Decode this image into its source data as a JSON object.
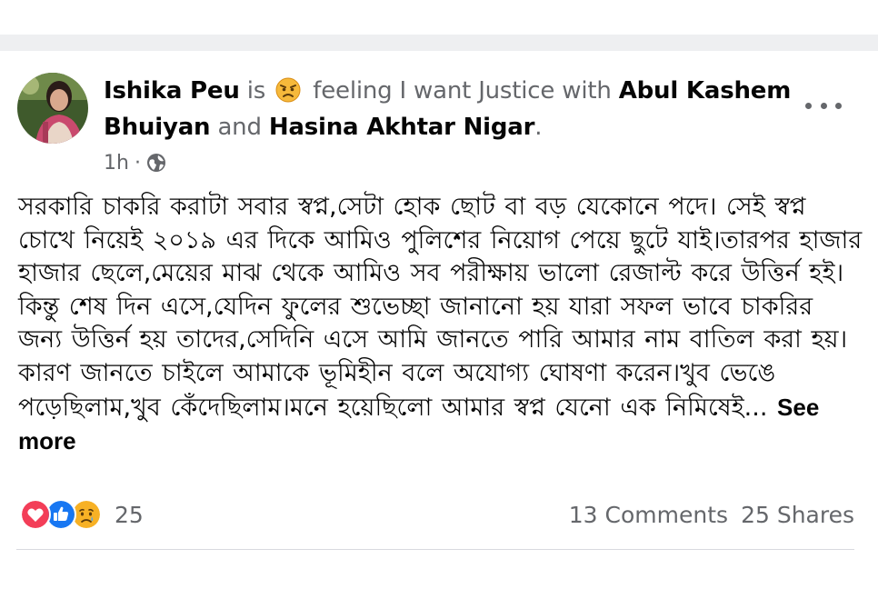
{
  "post": {
    "author": "Ishika Peu",
    "is_text": "is",
    "feeling_text": "feeling I want Justice with",
    "tagged_1": "Abul Kashem Bhuiyan",
    "and_text": "and",
    "tagged_2": "Hasina Akhtar Nigar",
    "period": ".",
    "feeling_icon": "angry-face-emoji",
    "time": "1h",
    "separator": "·",
    "privacy_icon": "globe-icon",
    "body": "সরকারি চাকরি করাটা সবার স্বপ্ন,সেটা হোক ছোট বা বড় যেকোনে পদে। সেই স্বপ্ন চোখে নিয়েই ২০১৯ এর দিকে আমিও পুলিশের নিয়োগ পেয়ে ছুটে যাই।তারপর হাজার হাজার ছেলে,মেয়ের মাঝ থেকে আমিও সব পরীক্ষায় ভালো রেজাল্ট করে উত্তির্ন হই।কিন্তু শেষ দিন এসে,যেদিন ফুলের শুভেচ্ছা জানানো হয় যারা সফল ভাবে চাকরির জন্য উত্তির্ন হয় তাদের,সেদিনি এসে আমি জানতে পারি আমার নাম বাতিল করা হয়।কারণ জানতে চাইলে আমাকে ভূমিহীন বলে অযোগ্য ঘোষণা করেন।খুব ভেঙে পড়েছিলাম,খুব কেঁদেছিলাম।মনে হয়েছিলো আমার স্বপ্ন যেনো এক নিমিষেই...",
    "see_more": "See more"
  },
  "footer": {
    "reaction_icons": [
      "love-icon",
      "like-icon",
      "sad-icon"
    ],
    "reaction_count": "25",
    "comments": "13 Comments",
    "shares": "25 Shares"
  },
  "colors": {
    "like_blue": "#1877f2",
    "love_red": "#f33e58",
    "sad_yellow": "#f7b125",
    "secondary_text": "#65676b"
  }
}
